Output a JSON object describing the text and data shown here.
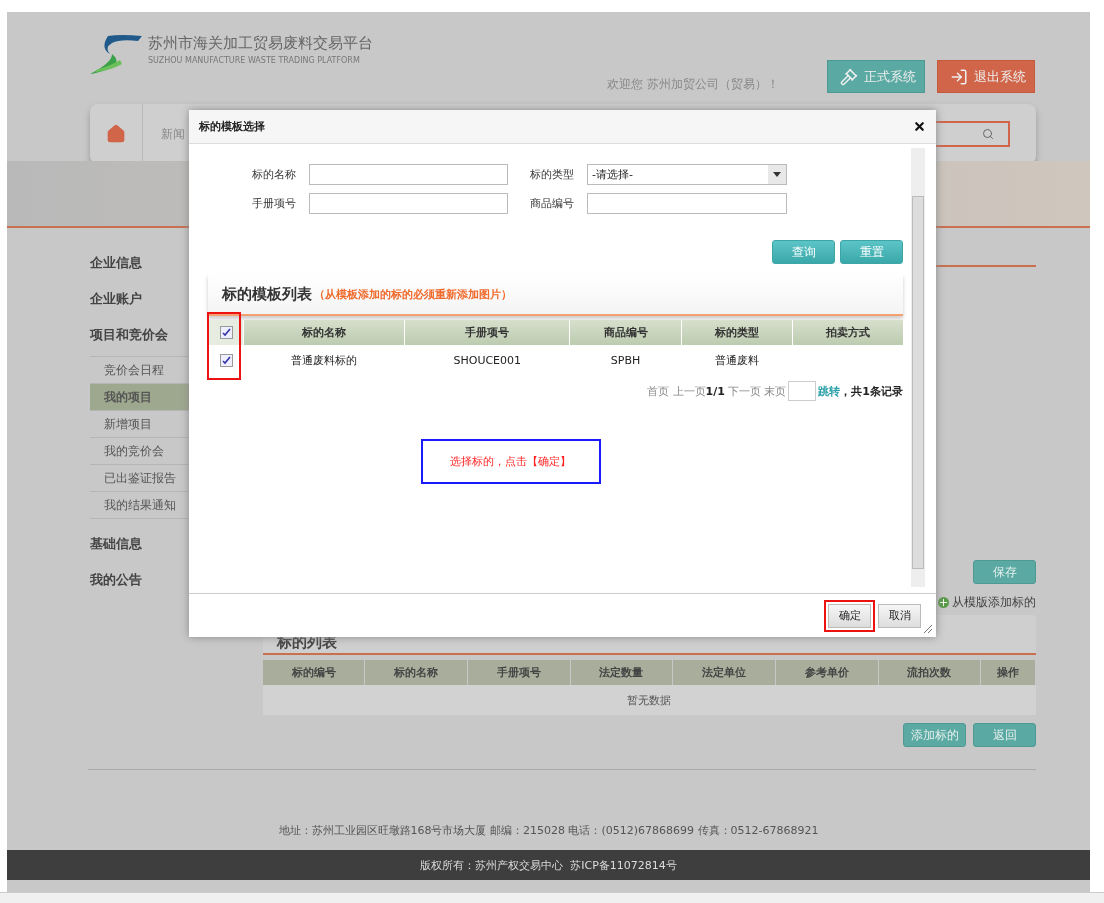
{
  "header": {
    "title": "苏州市海关加工贸易废料交易平台",
    "subtitle": "SUZHOU MANUFACTURE WASTE TRADING PLATFORM",
    "welcome": "欢迎您 苏州加贸公司（贸易）！",
    "buttons": [
      {
        "label": "正式系统",
        "kind": "formal"
      },
      {
        "label": "退出系统",
        "kind": "logout"
      }
    ]
  },
  "nav": {
    "items": [
      "新闻"
    ]
  },
  "sidebar": {
    "sections": [
      {
        "label": "企业信息"
      },
      {
        "label": "企业账户"
      },
      {
        "label": "项目和竞价会",
        "children": [
          {
            "label": "竞价会日程",
            "selected": false
          },
          {
            "label": "我的项目",
            "selected": true
          },
          {
            "label": "新增项目",
            "selected": false
          },
          {
            "label": "我的竞价会",
            "selected": false
          },
          {
            "label": "已出鉴证报告",
            "selected": false
          },
          {
            "label": "我的结果通知",
            "selected": false
          }
        ]
      },
      {
        "label": "基础信息"
      },
      {
        "label": "我的公告"
      }
    ]
  },
  "main": {
    "save_button": "保存",
    "add_from_template": "从模版添加标的",
    "list_title": "标的列表",
    "table": {
      "columns": [
        "标的编号",
        "标的名称",
        "手册项号",
        "法定数量",
        "法定单位",
        "参考单价",
        "流拍次数",
        "操作"
      ],
      "empty": "暂无数据"
    },
    "buttons": [
      "添加标的",
      "返回"
    ]
  },
  "footer": {
    "address": "地址：苏州工业园区旺墩路168号市场大厦 邮编：215028 电话：(0512)67868699 传真：0512-67868921",
    "copyright": "版权所有：苏州产权交易中心  苏ICP备11072814号"
  },
  "dialog": {
    "title": "标的模板选择",
    "fields": [
      {
        "label": "标的名称",
        "kind": "text"
      },
      {
        "label": "标的类型",
        "kind": "select",
        "value": "-请选择-"
      },
      {
        "label": "手册项号",
        "kind": "text"
      },
      {
        "label": "商品编号",
        "kind": "text"
      }
    ],
    "buttons": [
      "查询",
      "重置"
    ],
    "list_title": "标的模板列表",
    "list_note": "（从模板添加的标的必须重新添加图片）",
    "table": {
      "header_checked": true,
      "columns": [
        "标的名称",
        "手册项号",
        "商品编号",
        "标的类型",
        "拍卖方式"
      ],
      "rows": [
        {
          "checked": true,
          "cells": [
            "普通废料标的",
            "SHOUCE001",
            "SPBH",
            "普通废料"
          ]
        }
      ]
    },
    "pagination": {
      "prev": "首页 上一页",
      "page": "1/1",
      "next": "下一页 末页",
      "jump": "跳转",
      "total": "，共1条记录"
    },
    "hint": "选择标的，点击【确定】",
    "footer_buttons": [
      {
        "label": "确定",
        "highlighted": true
      },
      {
        "label": "取消",
        "highlighted": false
      }
    ]
  }
}
